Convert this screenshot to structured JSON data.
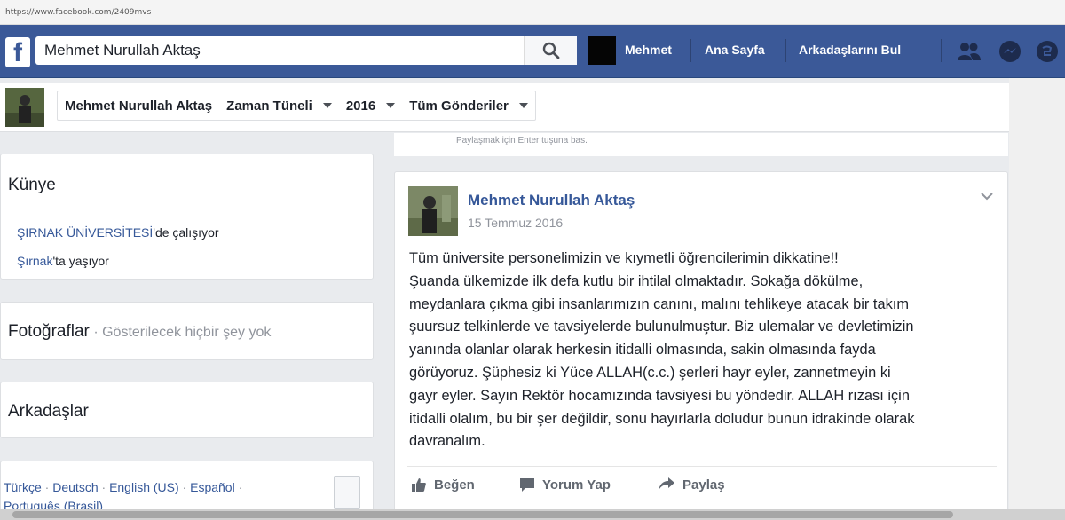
{
  "browser": {
    "url": "https://www.facebook.com/2409mvs"
  },
  "topnav": {
    "logo": "f",
    "search_value": "Mehmet Nurullah Aktaş",
    "user_name": "Mehmet",
    "home": "Ana Sayfa",
    "find_friends": "Arkadaşlarını Bul",
    "colors": {
      "bar": "#3b5998",
      "link": "#365899"
    }
  },
  "timeline_nav": {
    "name": "Mehmet Nurullah Aktaş",
    "timeline": "Zaman Tüneli",
    "year": "2016",
    "filter": "Tüm Gönderiler"
  },
  "composer_hint": "Paylaşmak için Enter tuşuna bas.",
  "sidebar": {
    "intro": {
      "title": "Künye",
      "work_link": "ŞIRNAK ÜNİVERSİTESİ",
      "work_suffix": "'de çalışıyor",
      "lives_link": "Şırnak",
      "lives_suffix": "'ta yaşıyor"
    },
    "photos": {
      "title": "Fotoğraflar",
      "separator": " · ",
      "empty": "Gösterilecek hiçbir şey yok"
    },
    "friends": {
      "title": "Arkadaşlar"
    },
    "languages": [
      "Türkçe",
      "Deutsch",
      "English (US)",
      "Español",
      "Português (Brasil)"
    ]
  },
  "post": {
    "author": "Mehmet Nurullah Aktaş",
    "date": "15 Temmuz 2016",
    "lines": [
      "Tüm üniversite personelimizin ve kıymetli öğrencilerimin dikkatine!!",
      "Şuanda ülkemizde ilk defa kutlu bir ihtilal olmaktadır. Sokağa dökülme,",
      "meydanlara çıkma gibi insanlarımızın canını, malını tehlikeye atacak bir takım",
      "şuursuz telkinlerde ve tavsiyelerde bulunulmuştur. Biz ulemalar ve devletimizin",
      "yanında olanlar olarak herkesin itidalli olmasında, sakin olmasında fayda",
      "görüyoruz. Şüphesiz ki Yüce ALLAH(c.c.) şerleri hayr eyler, zannetmeyin ki",
      "gayr eyler. Sayın Rektör hocamızında tavsiyesi bu yöndedir. ALLAH rızası için",
      "itidalli olalım, bu bir şer değildir, sonu hayırlarla doludur bunun idrakinde olarak",
      "davranalım."
    ],
    "actions": {
      "like": "Beğen",
      "comment": "Yorum Yap",
      "share": "Paylaş"
    }
  }
}
